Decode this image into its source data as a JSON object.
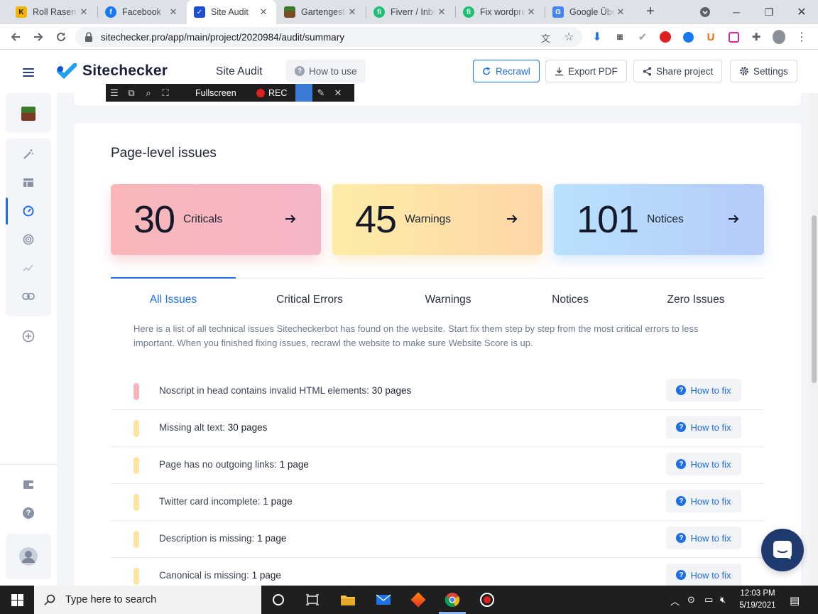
{
  "browser": {
    "tabs": [
      {
        "label": "Roll Rasen V",
        "favicon_letter": "K",
        "favicon_color": "#f5b400"
      },
      {
        "label": "Facebook",
        "favicon_letter": "f",
        "favicon_color": "#1877f2"
      },
      {
        "label": "Site Audit",
        "favicon_letter": "✓",
        "favicon_color": "#1c4fd6"
      },
      {
        "label": "Gartengesta",
        "favicon_letter": "",
        "favicon_color": "#6a4a2a"
      },
      {
        "label": "Fiverr / Inbo",
        "favicon_letter": "fi",
        "favicon_color": "#1dbf73"
      },
      {
        "label": "Fix wordpre",
        "favicon_letter": "fi",
        "favicon_color": "#1dbf73"
      },
      {
        "label": "Google Übe",
        "favicon_letter": "G",
        "favicon_color": "#4285f4"
      }
    ],
    "url": "sitechecker.pro/app/main/project/2020984/audit/summary"
  },
  "header": {
    "brand": "Sitechecker",
    "title": "Site Audit",
    "how_to_use": "How to use",
    "recrawl": "Recrawl",
    "export_pdf": "Export PDF",
    "share_project": "Share project",
    "settings": "Settings"
  },
  "recorder": {
    "fullscreen": "Fullscreen",
    "rec": "REC"
  },
  "main": {
    "section_title": "Page-level issues",
    "stats": {
      "criticals": {
        "value": "30",
        "label": "Criticals"
      },
      "warnings": {
        "value": "45",
        "label": "Warnings"
      },
      "notices": {
        "value": "101",
        "label": "Notices"
      }
    },
    "tabs": [
      "All Issues",
      "Critical Errors",
      "Warnings",
      "Notices",
      "Zero Issues"
    ],
    "active_tab": "All Issues",
    "description": "Here is a list of all technical issues Sitecheckerbot has found on the website. Start fix them step by step from the most critical errors to less important. When you finished fixing issues, recrawl the website to make sure Website Score is up.",
    "how_to_fix_label": "How to fix",
    "issues": [
      {
        "text": "Noscript in head contains invalid HTML elements:",
        "count": "30 pages",
        "severity": "critical",
        "color": "#f7b3bd"
      },
      {
        "text": "Missing alt text:",
        "count": "30 pages",
        "severity": "warning",
        "color": "#fde4a2"
      },
      {
        "text": "Page has no outgoing links:",
        "count": "1 page",
        "severity": "warning",
        "color": "#fde4a2"
      },
      {
        "text": "Twitter card incomplete:",
        "count": "1 page",
        "severity": "warning",
        "color": "#fde4a2"
      },
      {
        "text": "Description is missing:",
        "count": "1 page",
        "severity": "warning",
        "color": "#fde4a2"
      },
      {
        "text": "Canonical is missing:",
        "count": "1 page",
        "severity": "warning",
        "color": "#fde4a2"
      }
    ]
  },
  "taskbar": {
    "search_placeholder": "Type here to search",
    "time": "12:03 PM",
    "date": "5/19/2021"
  },
  "colors": {
    "accent": "#1e6fe6",
    "taskbar": "#1f1f1f"
  }
}
